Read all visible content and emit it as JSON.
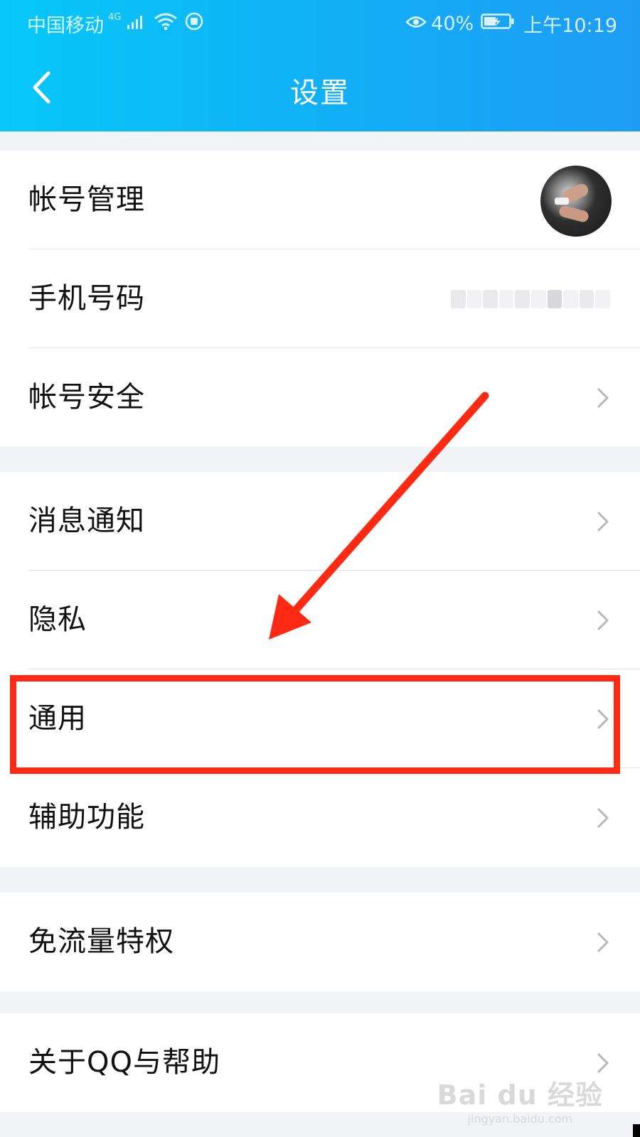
{
  "status_bar": {
    "carrier": "中国移动",
    "network": "4G",
    "battery_percent": "40%",
    "time": "上午10:19"
  },
  "nav": {
    "title": "设置"
  },
  "groups": [
    {
      "rows": [
        {
          "label": "帐号管理",
          "accessory": "avatar"
        },
        {
          "label": "手机号码",
          "accessory": "masked-phone"
        },
        {
          "label": "帐号安全",
          "accessory": "chevron"
        }
      ]
    },
    {
      "rows": [
        {
          "label": "消息通知",
          "accessory": "chevron"
        },
        {
          "label": "隐私",
          "accessory": "chevron"
        },
        {
          "label": "通用",
          "accessory": "chevron",
          "highlighted": true
        },
        {
          "label": "辅助功能",
          "accessory": "chevron"
        }
      ]
    },
    {
      "rows": [
        {
          "label": "免流量特权",
          "accessory": "chevron"
        }
      ]
    },
    {
      "rows": [
        {
          "label": "关于QQ与帮助",
          "accessory": "chevron"
        }
      ]
    }
  ],
  "colors": {
    "header_start": "#07c8f8",
    "header_end": "#1e9cf4",
    "annotation_red": "#ff2a13",
    "page_background": "#f2f3f6"
  },
  "watermark": {
    "logo": "Bai du 经验",
    "url": "jingyan.baidu.com"
  }
}
